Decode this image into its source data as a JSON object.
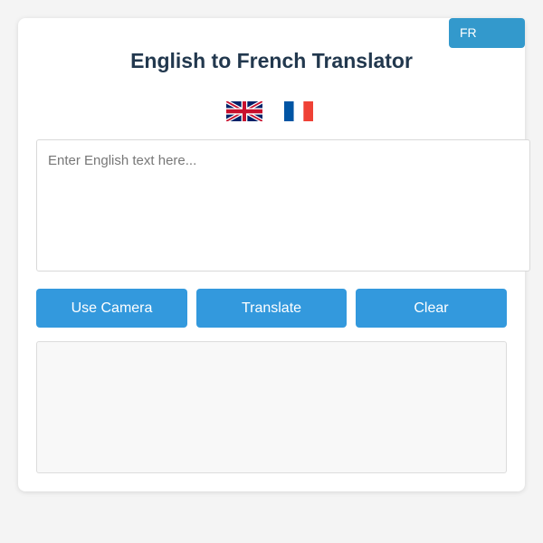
{
  "header": {
    "language_toggle_label": "FR",
    "title": "English to French Translator"
  },
  "flags": [
    {
      "name": "uk-flag-icon",
      "language": "English"
    },
    {
      "name": "france-flag-icon",
      "language": "French"
    }
  ],
  "input": {
    "placeholder": "Enter English text here...",
    "value": ""
  },
  "buttons": {
    "camera_label": "Use Camera",
    "translate_label": "Translate",
    "clear_label": "Clear"
  },
  "output": {
    "text": ""
  },
  "colors": {
    "accent": "#3399dd",
    "toggle": "#3399cc",
    "title": "#22384e",
    "background": "#f4f4f4"
  }
}
